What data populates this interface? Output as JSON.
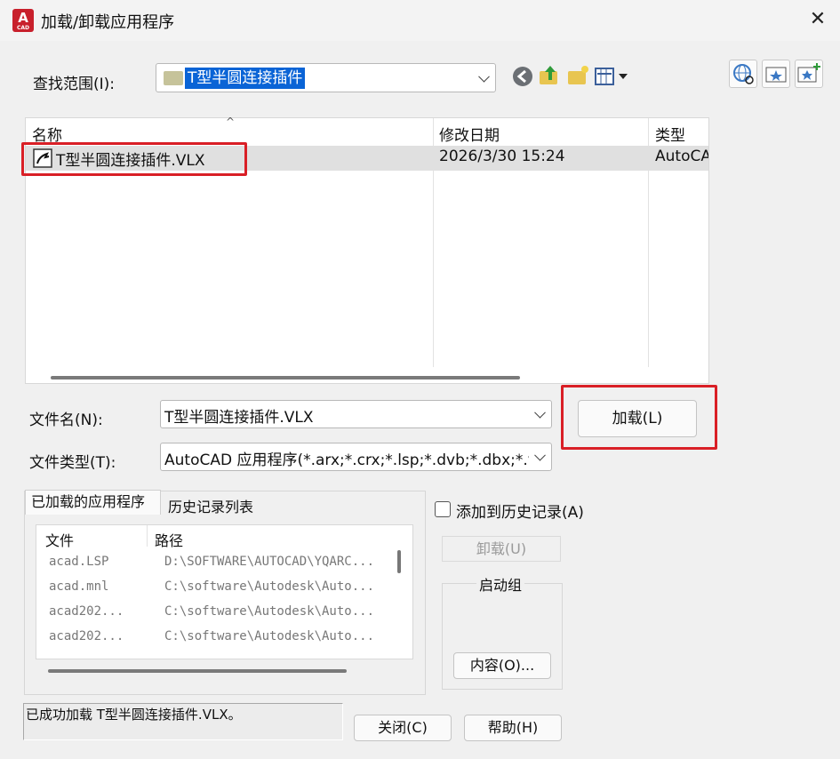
{
  "window": {
    "title": "加载/卸载应用程序",
    "app_icon_letter": "A",
    "app_icon_sub": "CAD"
  },
  "lookin": {
    "label": "查找范围(I):",
    "value": "T型半圆连接插件"
  },
  "file_list": {
    "columns": [
      "名称",
      "修改日期",
      "类型"
    ],
    "rows": [
      {
        "name": "T型半圆连接插件.VLX",
        "date": "2026/3/30 15:24",
        "type": "AutoCA"
      }
    ]
  },
  "filename": {
    "label": "文件名(N):",
    "value": "T型半圆连接插件.VLX"
  },
  "filetype": {
    "label": "文件类型(T):",
    "value": "AutoCAD 应用程序(*.arx;*.crx;*.lsp;*.dvb;*.dbx;*.v"
  },
  "load_button": "加载(L)",
  "tabs": [
    "已加载的应用程序",
    "历史记录列表"
  ],
  "loaded_list": {
    "columns": [
      "文件",
      "路径"
    ],
    "rows": [
      {
        "file": "acad.LSP",
        "path": "D:\\SOFTWARE\\AUTOCAD\\YQARC..."
      },
      {
        "file": "acad.mnl",
        "path": "C:\\software\\Autodesk\\Auto..."
      },
      {
        "file": "acad202...",
        "path": "C:\\software\\Autodesk\\Auto..."
      },
      {
        "file": "acad202...",
        "path": "C:\\software\\Autodesk\\Auto..."
      }
    ]
  },
  "add_history_label": "添加到历史记录(A)",
  "unload_button": "卸载(U)",
  "startup_group": {
    "title": "启动组",
    "contents_button": "内容(O)..."
  },
  "status_text": "已成功加载 T型半圆连接插件.VLX。",
  "close_button": "关闭(C)",
  "help_button": "帮助(H)",
  "colors": {
    "highlight": "#d91f26",
    "selection": "#0a64d6",
    "row_selected": "#e0e0e0"
  }
}
